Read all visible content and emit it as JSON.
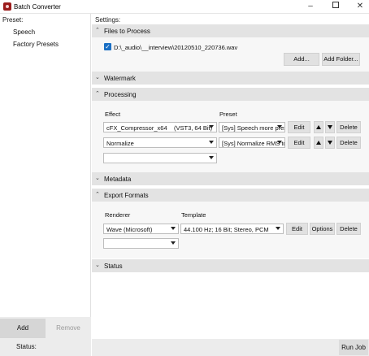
{
  "window": {
    "title": "Batch Converter",
    "minimize_glyph": "–",
    "close_glyph": "✕"
  },
  "presets": {
    "header": "Preset:",
    "items": [
      "Speech",
      "Factory Presets"
    ],
    "add_label": "Add",
    "remove_label": "Remove"
  },
  "status": {
    "label": "Status:"
  },
  "settings": {
    "label": "Settings:"
  },
  "sections": {
    "files": {
      "title": "Files to Process",
      "file_checked": true,
      "file_path": "D:\\_audio\\__interview\\20120510_220736.wav",
      "add_label": "Add...",
      "add_folder_label": "Add Folder..."
    },
    "watermark": {
      "title": "Watermark"
    },
    "processing": {
      "title": "Processing",
      "effect_col": "Effect",
      "preset_col": "Preset",
      "rows": [
        {
          "effect": "cFX_Compressor_x64",
          "info": "(VST3, 64 Bit)",
          "preset": "[Sys] Speech more pres"
        },
        {
          "effect": "Normalize",
          "info": "",
          "preset": "[Sys] Normalize RMS to"
        }
      ],
      "edit_label": "Edit",
      "delete_label": "Delete"
    },
    "metadata": {
      "title": "Metadata"
    },
    "export": {
      "title": "Export Formats",
      "renderer_col": "Renderer",
      "template_col": "Template",
      "renderer": "Wave (Microsoft)",
      "template": "44.100 Hz; 16 Bit; Stereo, PCM",
      "edit_label": "Edit",
      "options_label": "Options",
      "delete_label": "Delete"
    },
    "status": {
      "title": "Status"
    }
  },
  "run_job_label": "Run Job",
  "colors": {
    "accent": "#1a6fc4",
    "section_header": "#e3e3e3",
    "app_icon": "#9b1c1c"
  }
}
